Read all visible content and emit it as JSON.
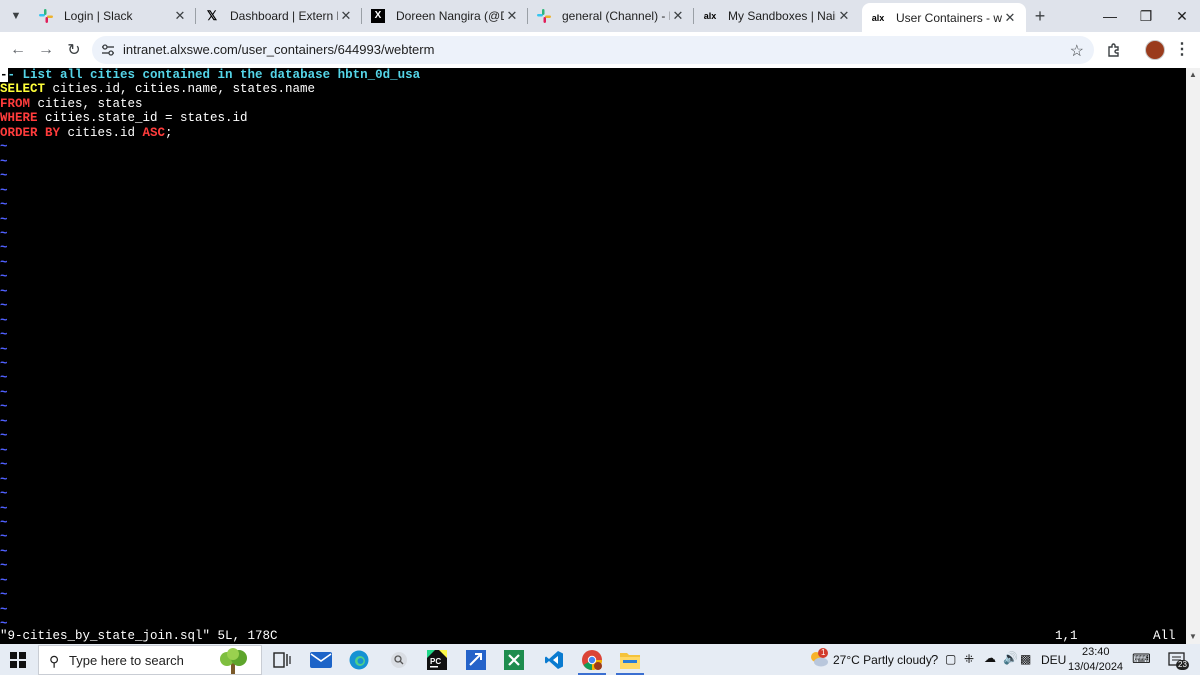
{
  "browser": {
    "tabs": [
      {
        "title": "Login | Slack",
        "favicon": "slack-icon"
      },
      {
        "title": "Dashboard | Extern Platfor",
        "favicon": "x-icon"
      },
      {
        "title": "Doreen Nangira (@Doreen",
        "favicon": "x-icon"
      },
      {
        "title": "general (Channel) - Energy",
        "favicon": "slack-icon"
      },
      {
        "title": "My Sandboxes | Nairobi In",
        "favicon": "alx-icon"
      },
      {
        "title": "User Containers - webterm",
        "favicon": "alx-icon",
        "active": true
      }
    ],
    "favicon_text": "alx",
    "url": "intranet.alxswe.com/user_containers/644993/webterm"
  },
  "terminal": {
    "lines": [
      {
        "segments": [
          {
            "text": "-",
            "style": "cursor"
          },
          {
            "text": "- List all cities contained in the database hbtn_0d_usa",
            "style": "comment"
          }
        ]
      },
      {
        "segments": [
          {
            "text": "SELECT",
            "style": "kw-y"
          },
          {
            "text": " cities.id, cities.name, states.name",
            "style": "text"
          }
        ]
      },
      {
        "segments": [
          {
            "text": "FROM",
            "style": "kw"
          },
          {
            "text": " cities, states",
            "style": "text"
          }
        ]
      },
      {
        "segments": [
          {
            "text": "WHERE",
            "style": "kw"
          },
          {
            "text": " cities.state_id = states.id",
            "style": "text"
          }
        ]
      },
      {
        "segments": [
          {
            "text": "ORDER BY",
            "style": "kw"
          },
          {
            "text": " cities.id ",
            "style": "text"
          },
          {
            "text": "ASC",
            "style": "kw"
          },
          {
            "text": ";",
            "style": "text"
          }
        ]
      }
    ],
    "tilde": "~",
    "tilde_rows": 34,
    "status_file": "\"9-cities_by_state_join.sql\" 5L, 178C",
    "status_pos": "1,1",
    "status_scroll": "All"
  },
  "taskbar": {
    "search_placeholder": "Type here to search",
    "weather": "27°C  Partly cloudy",
    "weather_badge": "1",
    "language": "DEU",
    "time": "23:40",
    "date": "13/04/2024",
    "notification_count": "23",
    "apps": [
      "task-view-icon",
      "mail-icon",
      "edge-icon",
      "search-app-icon",
      "pycharm-icon",
      "remote-desktop-icon",
      "excel-icon",
      "vscode-icon",
      "chrome-icon",
      "file-explorer-icon"
    ]
  }
}
